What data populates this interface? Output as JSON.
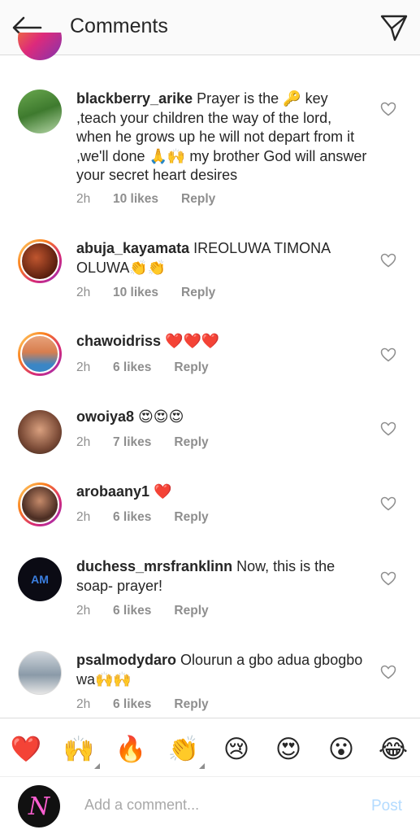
{
  "header": {
    "title": "Comments",
    "back_icon": "arrow-left-icon",
    "send_icon": "paper-plane-icon"
  },
  "comments": [
    {
      "username": "blackberry_arike",
      "text": "Prayer is the 🔑 key ,teach your children the way of the lord, when he grows up he will not depart from it ,we'll done 🙏🙌 my brother God will answer your secret heart desires",
      "time": "2h",
      "likes": "10 likes",
      "reply": "Reply"
    },
    {
      "username": "abuja_kayamata",
      "text": "IREOLUWA TIMONA OLUWA👏👏",
      "time": "2h",
      "likes": "10 likes",
      "reply": "Reply"
    },
    {
      "username": "chawoidriss",
      "text": "❤️❤️❤️",
      "time": "2h",
      "likes": "6 likes",
      "reply": "Reply"
    },
    {
      "username": "owoiya8",
      "text": "😍😍😍",
      "time": "2h",
      "likes": "7 likes",
      "reply": "Reply"
    },
    {
      "username": "arobaany1",
      "text": "❤️",
      "time": "2h",
      "likes": "6 likes",
      "reply": "Reply"
    },
    {
      "username": "duchess_mrsfranklinn",
      "text": "Now, this is the soap- prayer!",
      "time": "2h",
      "likes": "6 likes",
      "reply": "Reply"
    },
    {
      "username": "psalmodydaro",
      "text": "Olourun a gbo adua gbogbo wa🙌🙌",
      "time": "2h",
      "likes": "6 likes",
      "reply": "Reply"
    }
  ],
  "emoji_bar": [
    "❤️",
    "🙌",
    "🔥",
    "👏",
    "😢",
    "😍",
    "😮",
    "😂"
  ],
  "composer": {
    "placeholder": "Add a comment...",
    "post_label": "Post",
    "avatar_text": "N"
  },
  "colors": {
    "accent_blue_disabled": "#b3dbff",
    "story_ring_start": "#feda75",
    "story_ring_end": "#962fbf",
    "muted_text": "#8e8e8e"
  }
}
